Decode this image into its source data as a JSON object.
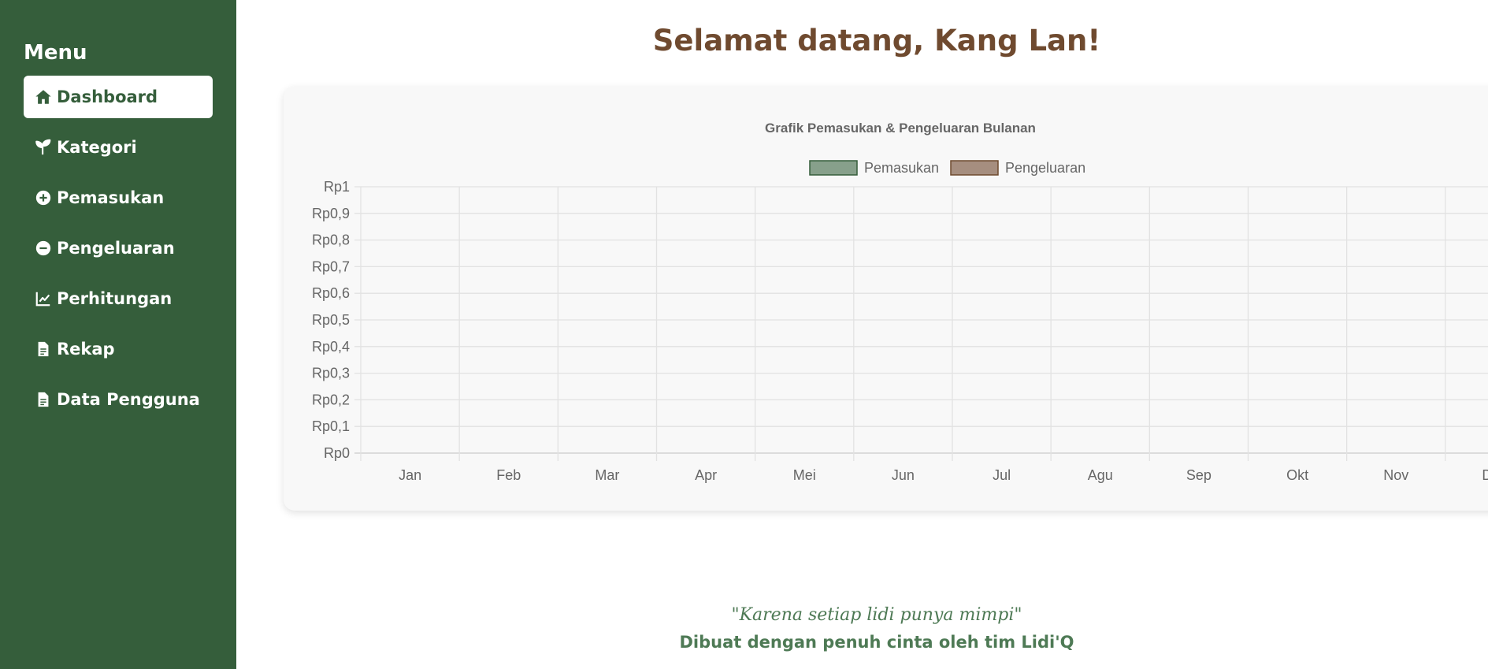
{
  "sidebar": {
    "title": "Menu",
    "items": [
      {
        "label": "Dashboard",
        "icon": "home-icon",
        "active": true
      },
      {
        "label": "Kategori",
        "icon": "sprout-icon"
      },
      {
        "label": "Pemasukan",
        "icon": "plus-circle-icon"
      },
      {
        "label": "Pengeluaran",
        "icon": "minus-circle-icon"
      },
      {
        "label": "Perhitungan",
        "icon": "line-chart-icon"
      },
      {
        "label": "Rekap",
        "icon": "document-icon"
      },
      {
        "label": "Data Pengguna",
        "icon": "document-icon"
      }
    ]
  },
  "welcome": "Selamat datang, Kang Lan!",
  "chart_data": {
    "type": "bar",
    "title": "Grafik Pemasukan & Pengeluaran Bulanan",
    "categories": [
      "Jan",
      "Feb",
      "Mar",
      "Apr",
      "Mei",
      "Jun",
      "Jul",
      "Agu",
      "Sep",
      "Okt",
      "Nov",
      "Des"
    ],
    "series": [
      {
        "name": "Pemasukan",
        "values": [
          0,
          0,
          0,
          0,
          0,
          0,
          0,
          0,
          0,
          0,
          0,
          0
        ],
        "color": "#87a08b",
        "border": "#355e3b"
      },
      {
        "name": "Pengeluaran",
        "values": [
          0,
          0,
          0,
          0,
          0,
          0,
          0,
          0,
          0,
          0,
          0,
          0
        ],
        "color": "#a68e7f",
        "border": "#6f4a2f"
      }
    ],
    "ylim": [
      0,
      1
    ],
    "yticks": [
      "Rp0",
      "Rp0,1",
      "Rp0,2",
      "Rp0,3",
      "Rp0,4",
      "Rp0,5",
      "Rp0,6",
      "Rp0,7",
      "Rp0,8",
      "Rp0,9",
      "Rp1"
    ],
    "legend": "top",
    "grid": true
  },
  "footer": {
    "quote": "\"Karena setiap lidi punya mimpi\"",
    "credit": "Dibuat dengan penuh cinta oleh tim Lidi'Q"
  }
}
